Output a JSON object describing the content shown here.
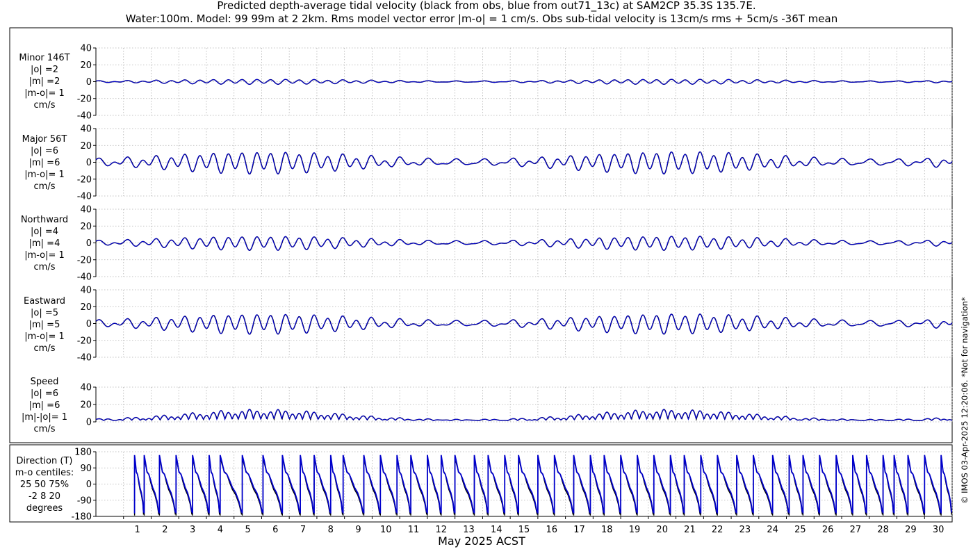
{
  "title": {
    "line1": "Predicted depth-average tidal velocity (black from obs, blue from out71_13c) at SAM2CP 35.3S 135.7E.",
    "line2": "Water:100m. Model: 99 99m at 2 2km. Rms model vector error |m-o| = 1 cm/s. Obs sub-tidal velocity is 13cm/s rms + 5cm/s -36T mean"
  },
  "credit": "© IMOS 03-Apr-2025 12:20:06. *Not for navigation*",
  "colors": {
    "obs": "#000000",
    "model": "#0000cc",
    "grid": "#b0b0b0"
  },
  "chart_data": [
    {
      "type": "line",
      "panel": "minor",
      "label_lines": [
        "Minor 146T",
        "|o| =2",
        "|m| =2",
        "|m-o|= 1",
        "cm/s"
      ],
      "ylim": [
        -40,
        40
      ],
      "yticks": [
        -40,
        -20,
        0,
        20,
        40
      ],
      "amplitude": 2.5,
      "offset": 0,
      "series": [
        {
          "color": "#000000"
        },
        {
          "color": "#0000cc"
        }
      ]
    },
    {
      "type": "line",
      "panel": "major",
      "label_lines": [
        "Major 56T",
        "|o| =6",
        "|m| =6",
        "|m-o|= 1",
        "cm/s"
      ],
      "ylim": [
        -40,
        40
      ],
      "yticks": [
        -40,
        -20,
        0,
        20,
        40
      ],
      "amplitude": 11,
      "offset": 0,
      "series": [
        {
          "color": "#000000"
        },
        {
          "color": "#0000cc"
        }
      ]
    },
    {
      "type": "line",
      "panel": "north",
      "label_lines": [
        "Northward",
        "|o| =4",
        "|m| =4",
        "|m-o|= 1",
        "cm/s"
      ],
      "ylim": [
        -40,
        40
      ],
      "yticks": [
        -40,
        -20,
        0,
        20,
        40
      ],
      "amplitude": 7,
      "offset": 0,
      "series": [
        {
          "color": "#000000"
        },
        {
          "color": "#0000cc"
        }
      ]
    },
    {
      "type": "line",
      "panel": "east",
      "label_lines": [
        "Eastward",
        "|o| =5",
        "|m| =5",
        "|m-o|= 1",
        "cm/s"
      ],
      "ylim": [
        -40,
        40
      ],
      "yticks": [
        -40,
        -20,
        0,
        20,
        40
      ],
      "amplitude": 10,
      "offset": 0,
      "series": [
        {
          "color": "#000000"
        },
        {
          "color": "#0000cc"
        }
      ]
    },
    {
      "type": "line",
      "panel": "speed",
      "label_lines": [
        "Speed",
        "|o| =6",
        "|m| =6",
        "|m|-|o|= 1",
        "cm/s"
      ],
      "ylim": [
        0,
        40
      ],
      "yticks": [
        0,
        20,
        40
      ],
      "amplitude": 12,
      "offset": 0,
      "series": [
        {
          "color": "#000000"
        },
        {
          "color": "#0000cc"
        }
      ]
    },
    {
      "type": "line",
      "panel": "direction",
      "label_lines": [
        "Direction (T)",
        "m-o centiles:",
        "25  50  75%",
        "-2   8  20",
        "degrees"
      ],
      "ylim": [
        -180,
        180
      ],
      "yticks": [
        -180,
        -90,
        0,
        90,
        180
      ],
      "series": [
        {
          "color": "#000000"
        },
        {
          "color": "#0000cc"
        }
      ]
    }
  ],
  "xaxis": {
    "label": "May 2025 ACST",
    "days": [
      "1",
      "2",
      "3",
      "4",
      "5",
      "6",
      "7",
      "8",
      "9",
      "10",
      "11",
      "12",
      "13",
      "14",
      "15",
      "16",
      "17",
      "18",
      "19",
      "20",
      "21",
      "22",
      "23",
      "24",
      "25",
      "26",
      "27",
      "28",
      "29",
      "30"
    ]
  }
}
